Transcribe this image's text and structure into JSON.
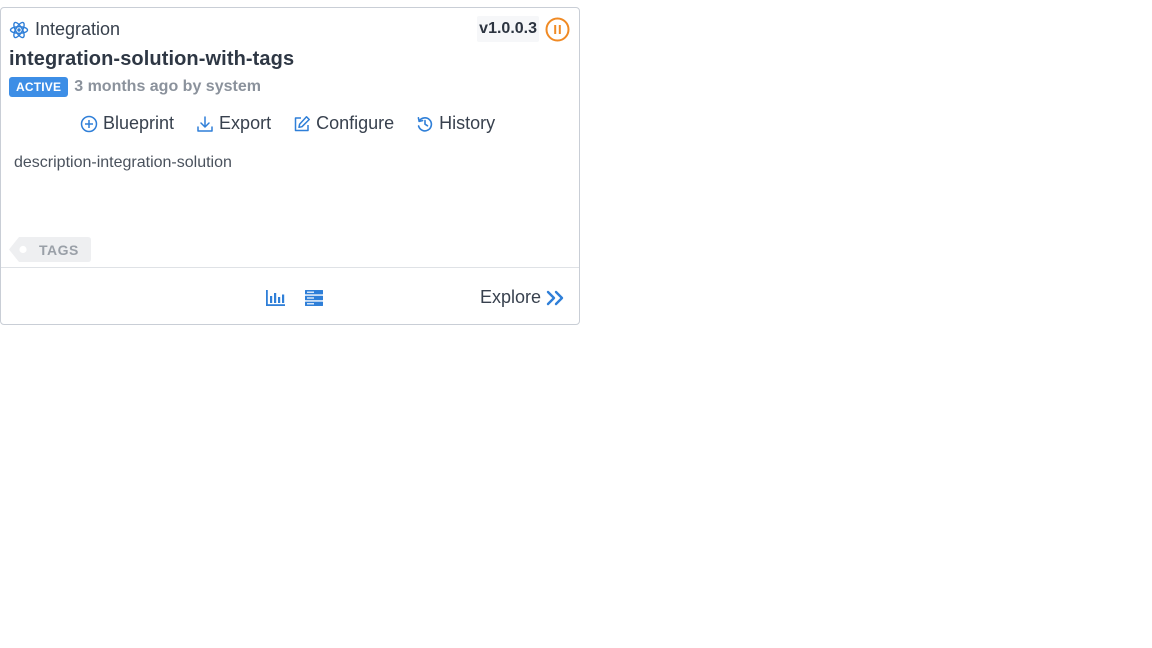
{
  "card": {
    "type_label": "Integration",
    "version": "v1.0.0.3",
    "title": "integration-solution-with-tags",
    "status_badge": "ACTIVE",
    "meta": "3 months ago by system",
    "description": "description-integration-solution",
    "tag_label": "TAGS",
    "actions": {
      "blueprint": "Blueprint",
      "export": "Export",
      "configure": "Configure",
      "history": "History"
    },
    "explore_label": "Explore"
  },
  "icons": {
    "type": "atom-icon",
    "status": "pause-circle-icon",
    "blueprint": "plus-circle-icon",
    "export": "download-icon",
    "configure": "edit-icon",
    "history": "history-icon",
    "chart": "bar-chart-icon",
    "server": "server-icon",
    "explore": "double-chevron-right-icon"
  },
  "colors": {
    "accent": "#2f7fd8",
    "badge": "#3d8ee6",
    "pause": "#f08a24"
  }
}
